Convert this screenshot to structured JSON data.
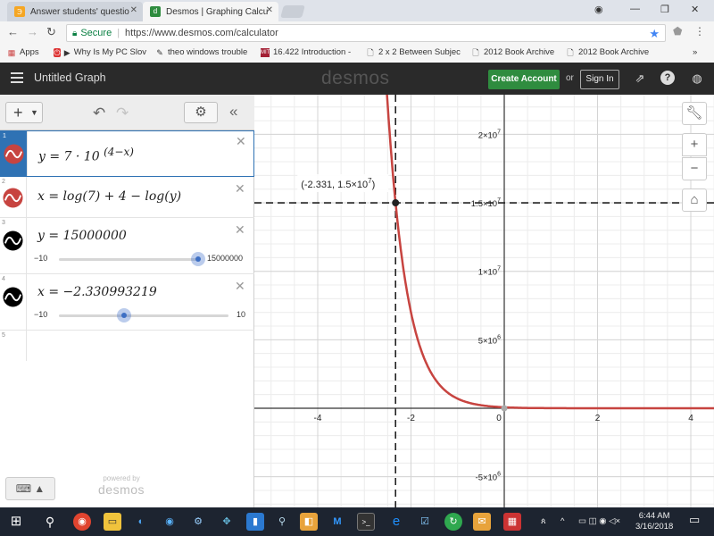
{
  "browser": {
    "tabs": [
      {
        "label": "Answer students' questio",
        "favicon": "chegg-icon",
        "active": false
      },
      {
        "label": "Desmos | Graphing Calcu",
        "favicon": "desmos-icon",
        "active": true
      }
    ],
    "address": {
      "secure_label": "Secure",
      "url": "https://www.desmos.com/calculator"
    },
    "bookmarks": [
      {
        "label": "Apps",
        "icon": "apps-grid-icon"
      },
      {
        "label": "Why Is My PC Slov",
        "icon": "red-play-icon"
      },
      {
        "label": "theo windows trouble",
        "icon": "theo-icon"
      },
      {
        "label": "16.422 Introduction -",
        "icon": "mit-icon"
      },
      {
        "label": "2 x 2 Between Subjec",
        "icon": "page-icon"
      },
      {
        "label": "2012 Book Archive",
        "icon": "page-icon"
      },
      {
        "label": "2012 Book Archive",
        "icon": "page-icon"
      }
    ],
    "overflow_label": "»"
  },
  "header": {
    "graph_title": "Untitled Graph",
    "logo": "desmos",
    "create_account_label": "Create Account",
    "or_label": "or",
    "sign_in_label": "Sign In"
  },
  "expressions": [
    {
      "index": "1",
      "math": "y = 7 · 10",
      "exponent": "(4−x)",
      "color": "#c74440",
      "selected": true
    },
    {
      "index": "2",
      "math": "x = log(7) + 4 − log(y)",
      "color": "#c74440",
      "selected": false
    },
    {
      "index": "3",
      "math": "y = 15000000",
      "color": "#000000",
      "slider": {
        "min": "−10",
        "max": "15000000",
        "value_fraction": 1.0
      }
    },
    {
      "index": "4",
      "math": "x = −2.330993219",
      "color": "#000000",
      "slider": {
        "min": "−10",
        "max": "10",
        "value_fraction": 0.383
      }
    },
    {
      "index": "5",
      "math": ""
    }
  ],
  "footer": {
    "powered_by": "powered by",
    "brand": "desmos"
  },
  "graph": {
    "point_label": "(-2.331, 1.5×10",
    "point_label_exp": "7",
    "point_label_close": ")",
    "x_ticks": [
      {
        "value": -4,
        "label": "-4"
      },
      {
        "value": -2,
        "label": "-2"
      },
      {
        "value": 0,
        "label": "0"
      },
      {
        "value": 2,
        "label": "2"
      },
      {
        "value": 4,
        "label": "4"
      }
    ],
    "y_ticks": [
      {
        "value": 20000000,
        "base": "2×10",
        "exp": "7"
      },
      {
        "value": 15000000,
        "base": "1.5×10",
        "exp": "7"
      },
      {
        "value": 10000000,
        "base": "1×10",
        "exp": "7"
      },
      {
        "value": 5000000,
        "base": "5×10",
        "exp": "6"
      },
      {
        "value": -5000000,
        "base": "-5×10",
        "exp": "6"
      }
    ],
    "curve_color": "#c74440",
    "intersection": {
      "x": -2.331,
      "y": 15000000
    }
  },
  "graph_controls": [
    {
      "name": "graph-settings-wrench-button",
      "icon": "wrench-icon"
    },
    {
      "name": "zoom-in-button",
      "icon": "plus-icon",
      "glyph": "+"
    },
    {
      "name": "zoom-out-button",
      "icon": "minus-icon",
      "glyph": "−"
    },
    {
      "name": "default-viewport-button",
      "icon": "home-icon"
    }
  ],
  "taskbar": {
    "time": "6:44 AM",
    "date": "3/16/2018"
  }
}
